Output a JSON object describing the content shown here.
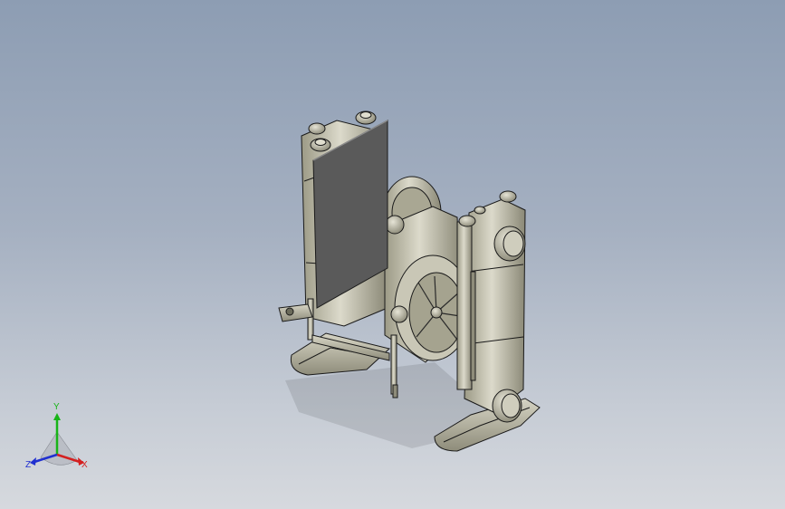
{
  "viewport": {
    "background_top": "#8d9db3",
    "background_bottom": "#d6d9de",
    "model": {
      "part_color": "#b9b7a3",
      "panel_color": "#5a5a5a",
      "edge_color": "#1a1a1a"
    }
  },
  "triad": {
    "labels": {
      "x": "X",
      "y": "Y",
      "z": "Z"
    },
    "colors": {
      "x": "#d42020",
      "y": "#18b418",
      "z": "#2030d0"
    }
  }
}
